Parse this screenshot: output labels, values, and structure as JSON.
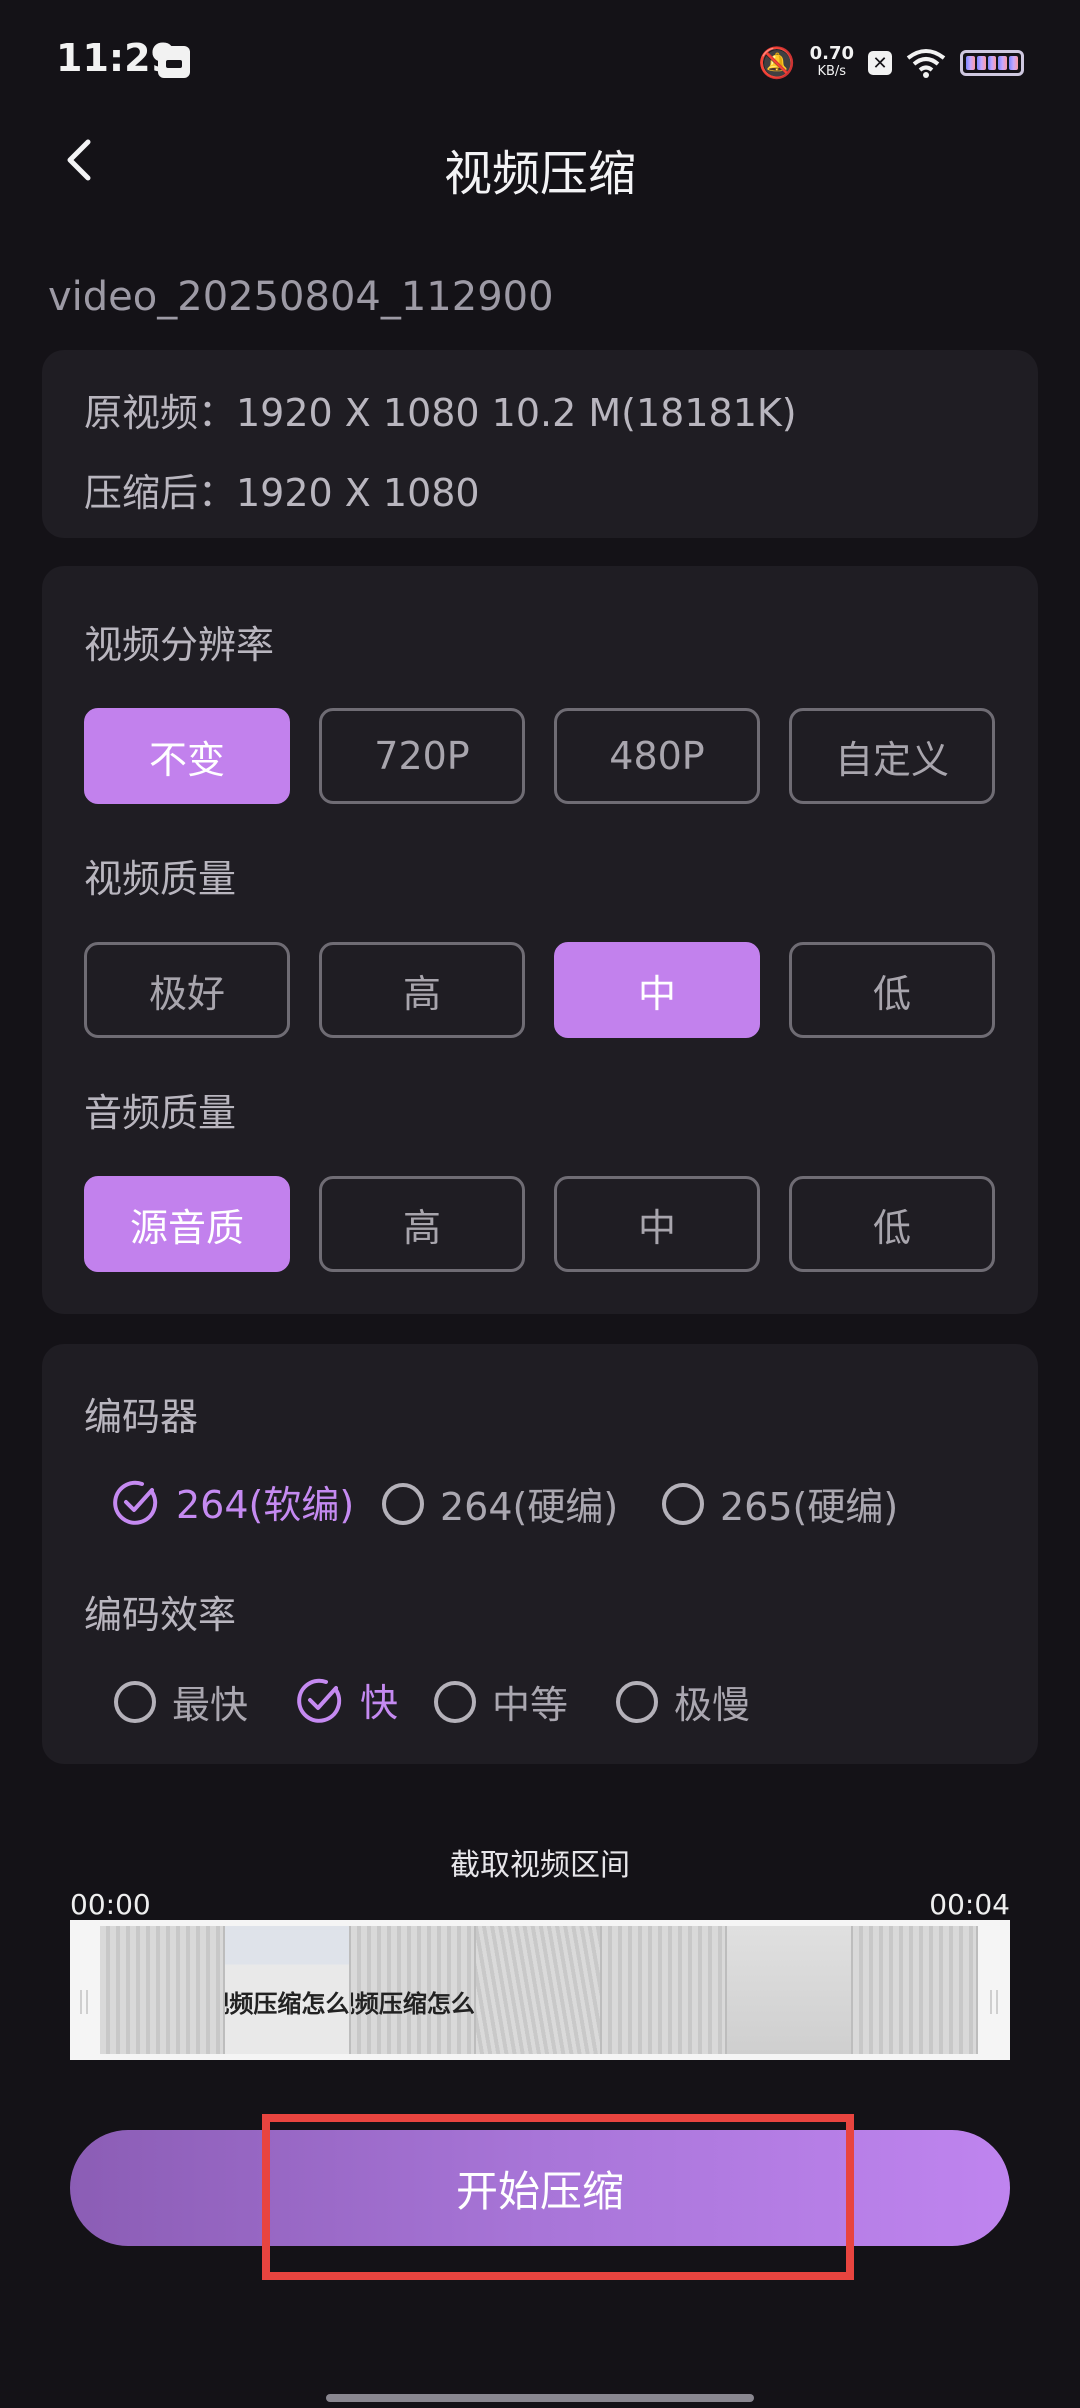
{
  "status_bar": {
    "time": "11:29",
    "net_speed_value": "0.70",
    "net_speed_unit": "KB/s",
    "icons": [
      "notification-muted-icon",
      "close-box-icon",
      "wifi-icon",
      "battery-icon"
    ]
  },
  "header": {
    "title": "视频压缩",
    "back_icon": "chevron-left-icon"
  },
  "file_name": "video_20250804_112900",
  "info": {
    "original": "原视频：1920 X 1080 10.2 M(18181K)",
    "compressed": "压缩后：1920 X 1080"
  },
  "resolution": {
    "label": "视频分辨率",
    "options": [
      "不变",
      "720P",
      "480P",
      "自定义"
    ],
    "selected": "不变"
  },
  "video_quality": {
    "label": "视频质量",
    "options": [
      "极好",
      "高",
      "中",
      "低"
    ],
    "selected": "中"
  },
  "audio_quality": {
    "label": "音频质量",
    "options": [
      "源音质",
      "高",
      "中",
      "低"
    ],
    "selected": "源音质"
  },
  "encoder": {
    "label": "编码器",
    "options": [
      "264(软编)",
      "264(硬编)",
      "265(硬编)"
    ],
    "selected": "264(软编)"
  },
  "efficiency": {
    "label": "编码效率",
    "options": [
      "最快",
      "快",
      "中等",
      "极慢"
    ],
    "selected": "快"
  },
  "trim": {
    "title": "截取视频区间",
    "start": "00:00",
    "end": "00:04",
    "frame_caption": "视频压缩怎么用"
  },
  "start_button": "开始压缩",
  "colors": {
    "accent": "#c281ed",
    "background": "#141217",
    "card": "#1f1d23",
    "highlight": "#e8443f"
  }
}
